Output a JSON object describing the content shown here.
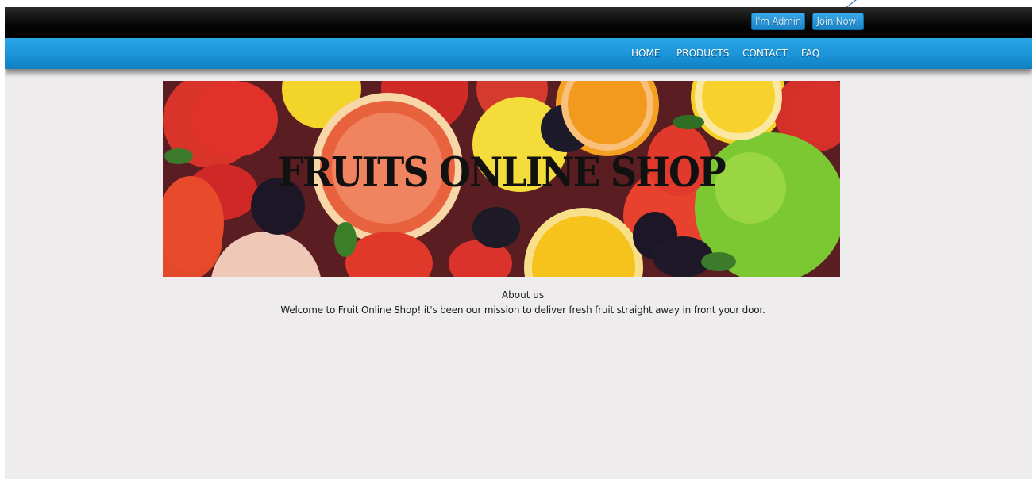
{
  "header": {
    "admin_button": "I'm Admin",
    "join_button": "Join Now!"
  },
  "nav": {
    "items": [
      {
        "label": "HOME"
      },
      {
        "label": "PRODUCTS"
      },
      {
        "label": "CONTACT"
      },
      {
        "label": "FAQ"
      }
    ]
  },
  "banner": {
    "title": "FRUITS ONLINE SHOP"
  },
  "about": {
    "heading": "About us",
    "text": "Welcome to Fruit Online Shop! it's been our mission to deliver fresh fruit straight away in front your door."
  },
  "colors": {
    "topbar": "#000000",
    "nav_blue": "#1b94d8",
    "page_background": "#eeecec",
    "button_blue": "#1a84c8"
  }
}
